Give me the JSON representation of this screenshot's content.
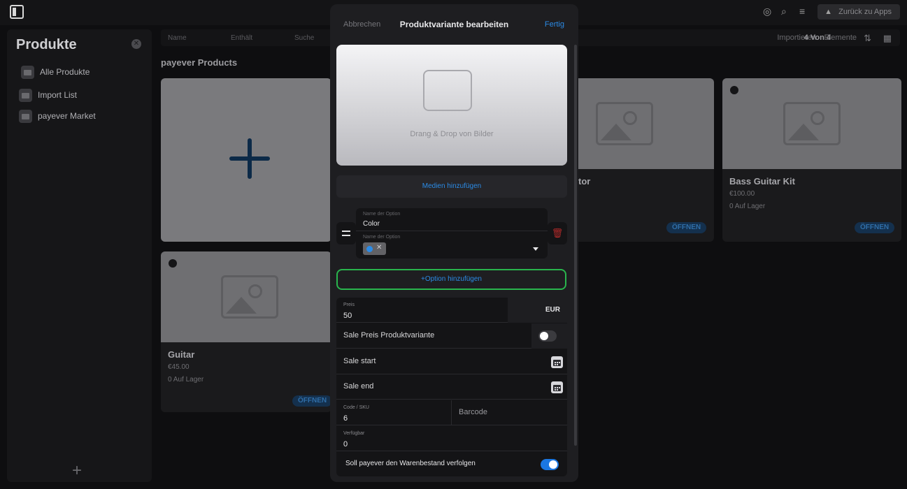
{
  "header": {
    "back_label": "Zurück zu Apps"
  },
  "sidebar": {
    "title": "Produkte",
    "items": [
      {
        "label": "Alle Produkte"
      },
      {
        "label": "Import List"
      },
      {
        "label": "payever Market"
      }
    ]
  },
  "toolbar": {
    "col_name": "Name",
    "col_contains": "Enthält",
    "col_search": "Suche",
    "import_label": "Importieren",
    "count_label": "4 Von 4",
    "elements_label": "Elemente"
  },
  "section": {
    "title": "payever Products"
  },
  "products": [
    {
      "name": "Guitar",
      "price": "€45.00",
      "stock": "0 Auf Lager",
      "open": "ÖFFNEN"
    },
    {
      "name": "tor",
      "open": "ÖFFNEN"
    },
    {
      "name": "Bass Guitar Kit",
      "price": "€100.00",
      "stock": "0 Auf Lager",
      "open": "ÖFFNEN"
    }
  ],
  "modal": {
    "cancel": "Abbrechen",
    "title": "Produktvariante bearbeiten",
    "done": "Fertig",
    "dropzone_text": "Drang & Drop von Bilder",
    "media_button": "Medien hinzufügen",
    "option": {
      "name_label": "Name der Option",
      "name_value": "Color",
      "value_label": "Name der Option",
      "chip_color": "#2b8be6"
    },
    "add_option": "+Option hinzufügen",
    "price": {
      "label": "Preis",
      "value": "50",
      "currency": "EUR"
    },
    "sale_price": {
      "label": "Sale Preis Produktvariante",
      "enabled": false
    },
    "sale_start": "Sale start",
    "sale_end": "Sale end",
    "sku": {
      "label": "Code / SKU",
      "value": "6"
    },
    "barcode": "Barcode",
    "available": {
      "label": "Verfügbar",
      "value": "0"
    },
    "track": {
      "label": "Soll payever den Warenbestand verfolgen",
      "enabled": true
    }
  }
}
